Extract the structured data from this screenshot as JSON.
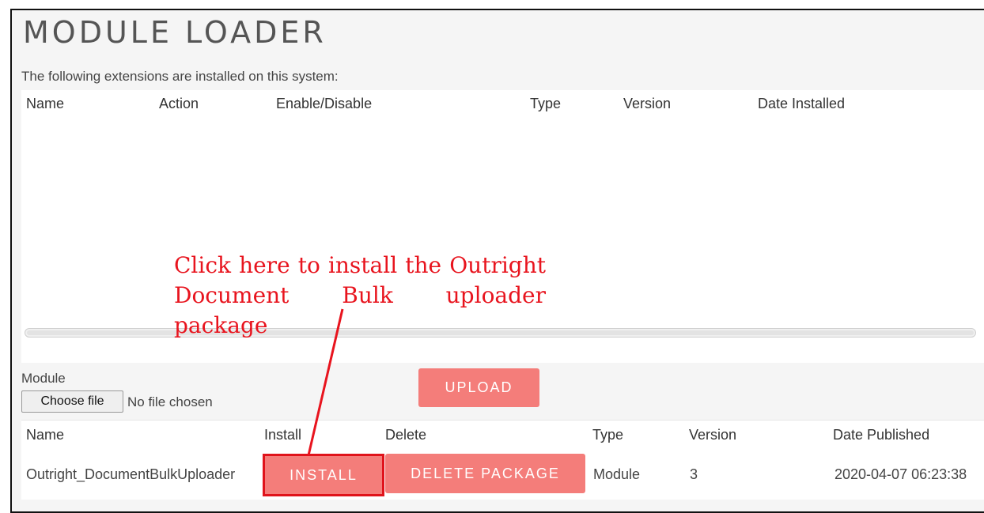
{
  "page": {
    "title": "MODULE LOADER",
    "intro": "The following extensions are installed on this system:"
  },
  "installed_table": {
    "columns": [
      "Name",
      "Action",
      "Enable/Disable",
      "Type",
      "Version",
      "Date Installed"
    ],
    "rows": []
  },
  "upload": {
    "module_label": "Module",
    "choose_file_label": "Choose file",
    "no_file_text": "No file chosen",
    "upload_label": "UPLOAD"
  },
  "packages_table": {
    "columns": [
      "Name",
      "Install",
      "Delete",
      "Type",
      "Version",
      "Date Published"
    ],
    "rows": [
      {
        "name": "Outright_DocumentBulkUploader",
        "install_label": "INSTALL",
        "delete_label": "DELETE PACKAGE",
        "type": "Module",
        "version": "3",
        "date_published": "2020-04-07 06:23:38"
      }
    ]
  },
  "annotation": {
    "text": "Click here to install the Outright Document Bulk uploader package",
    "color": "#e8141e"
  },
  "colors": {
    "accent_button": "#f47d7a",
    "highlight_border": "#e0131b",
    "panel_bg": "#ffffff",
    "page_bg": "#f5f5f5"
  }
}
